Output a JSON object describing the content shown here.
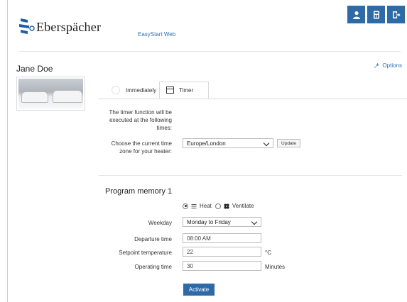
{
  "brand": {
    "logo_text": "Eberspächer",
    "app_name": "EasyStart Web"
  },
  "header": {
    "buttons": [
      {
        "name": "user",
        "icon": "user-icon"
      },
      {
        "name": "device",
        "icon": "device-icon"
      },
      {
        "name": "logout",
        "icon": "logout-icon"
      }
    ]
  },
  "user": {
    "name": "Jane Doe"
  },
  "options_label": "Options",
  "tabs": [
    {
      "label": "Immediately",
      "active": false
    },
    {
      "label": "Timer",
      "active": true
    }
  ],
  "timer": {
    "description": "The timer function will be executed at the following times:",
    "tz_label": "Choose the current time zone for your heater:",
    "tz_value": "Europe/London",
    "update_label": "Update"
  },
  "program": {
    "title": "Program memory 1",
    "mode_heat": "Heat",
    "mode_ventilate": "Ventilate",
    "selected_mode": "Heat",
    "weekday_label": "Weekday",
    "weekday_value": "Monday to Friday",
    "departure_label": "Departure time",
    "departure_value": "08:00 AM",
    "setpoint_label": "Setpoint temperature",
    "setpoint_value": "22",
    "setpoint_unit": "°C",
    "operating_label": "Operating time",
    "operating_value": "30",
    "operating_unit": "Minutes",
    "activate_label": "Activate"
  },
  "colors": {
    "accent": "#2d6aa6",
    "link": "#2f6fb3"
  }
}
